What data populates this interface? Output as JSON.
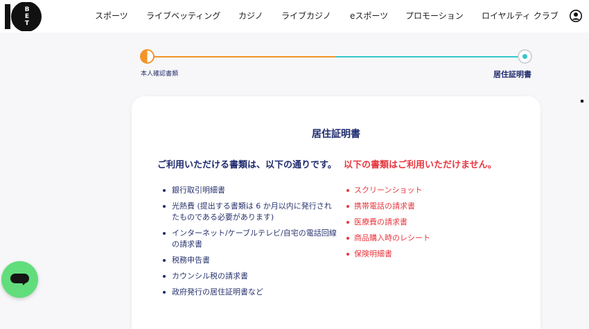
{
  "header": {
    "logo_text": "10BET",
    "nav": [
      {
        "label": "スポーツ"
      },
      {
        "label": "ライブベッティング"
      },
      {
        "label": "カジノ"
      },
      {
        "label": "ライブカジノ"
      },
      {
        "label": "eスポーツ"
      },
      {
        "label": "プロモーション"
      },
      {
        "label": "ロイヤルティ クラブ"
      }
    ],
    "account_icon": "user-circle-icon"
  },
  "progress": {
    "step1_label": "本人確認書類",
    "step2_label": "居住証明書",
    "completed_fraction": 0.5
  },
  "card": {
    "title": "居住証明書",
    "accepted": {
      "heading": "ご利用いただける書類は、以下の通りです。",
      "items": [
        "銀行取引明細書",
        "光熱費 (提出する書類は 6 か月以内に発行されたものである必要があります)",
        "インターネット/ケーブルテレビ/自宅の電話回線の請求書",
        "税務申告書",
        "カウンシル税の請求書",
        "政府発行の居住証明書など"
      ]
    },
    "rejected": {
      "heading": "以下の書類はご利用いただけません。",
      "items": [
        "スクリーンショット",
        "携帯電話の請求書",
        "医療費の請求書",
        "商品購入時のレシート",
        "保険明細書"
      ]
    }
  },
  "chat": {
    "icon": "chat-bubble-icon"
  },
  "colors": {
    "accent_orange": "#f2952a",
    "accent_teal": "#35c6c9",
    "navy": "#1e2a6e",
    "error_red": "#e8353d",
    "chat_green": "#62dd7c"
  }
}
